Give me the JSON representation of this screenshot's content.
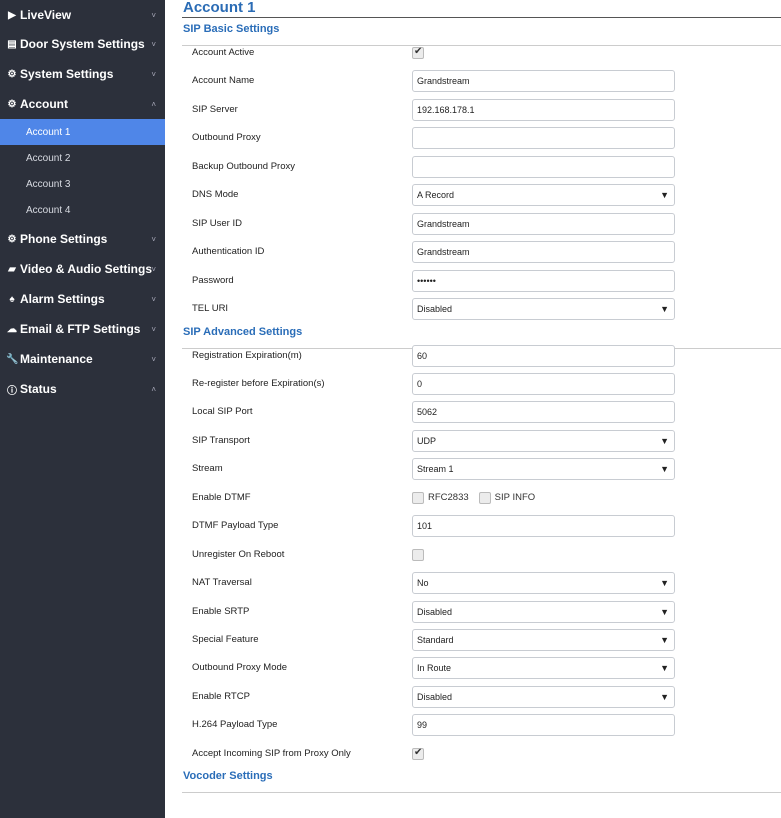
{
  "sidebar": {
    "items": [
      {
        "label": "LiveView",
        "icon": "video-play-icon",
        "glyph": "▶",
        "chev": "˅"
      },
      {
        "label": "Door System Settings",
        "icon": "door-card-icon",
        "glyph": "▤",
        "chev": "˅"
      },
      {
        "label": "System Settings",
        "icon": "gears-icon",
        "glyph": "⚙",
        "chev": "˅"
      },
      {
        "label": "Account",
        "icon": "gears-icon",
        "glyph": "⚙",
        "chev": "˄"
      },
      {
        "label": "Phone Settings",
        "icon": "gears-icon",
        "glyph": "⚙",
        "chev": "˅"
      },
      {
        "label": "Video & Audio Settings",
        "icon": "camera-icon",
        "glyph": "▰",
        "chev": "˅"
      },
      {
        "label": "Alarm Settings",
        "icon": "bell-icon",
        "glyph": "♠",
        "chev": "˅"
      },
      {
        "label": "Email & FTP Settings",
        "icon": "cloud-icon",
        "glyph": "☁",
        "chev": "˅"
      },
      {
        "label": "Maintenance",
        "icon": "wrench-icon",
        "glyph": "🔧",
        "chev": "˅"
      },
      {
        "label": "Status",
        "icon": "info-icon",
        "glyph": "ⓘ",
        "chev": "˄"
      }
    ],
    "sub_items": [
      {
        "label": "Account 1",
        "active": true
      },
      {
        "label": "Account 2"
      },
      {
        "label": "Account 3"
      },
      {
        "label": "Account 4"
      }
    ]
  },
  "main": {
    "title": "Account 1",
    "sections": [
      {
        "title": "SIP Basic Settings",
        "rows": [
          {
            "label": "Account Active",
            "type": "checkbox",
            "checked": true
          },
          {
            "label": "Account Name",
            "type": "text",
            "value": "Grandstream"
          },
          {
            "label": "SIP Server",
            "type": "text",
            "value": "192.168.178.1"
          },
          {
            "label": "Outbound Proxy",
            "type": "text",
            "value": ""
          },
          {
            "label": "Backup Outbound Proxy",
            "type": "text",
            "value": ""
          },
          {
            "label": "DNS Mode",
            "type": "select",
            "value": "A Record"
          },
          {
            "label": "SIP User ID",
            "type": "text",
            "value": "Grandstream"
          },
          {
            "label": "Authentication ID",
            "type": "text",
            "value": "Grandstream"
          },
          {
            "label": "Password",
            "type": "text",
            "value": "••••••"
          },
          {
            "label": "TEL URI",
            "type": "select",
            "value": "Disabled"
          }
        ]
      },
      {
        "title": "SIP Advanced Settings",
        "rows": [
          {
            "label": "Registration Expiration(m)",
            "type": "text",
            "value": "60"
          },
          {
            "label": "Re-register before Expiration(s)",
            "type": "text",
            "value": "0"
          },
          {
            "label": "Local SIP Port",
            "type": "text",
            "value": "5062"
          },
          {
            "label": "SIP Transport",
            "type": "select",
            "value": "UDP"
          },
          {
            "label": "Stream",
            "type": "select",
            "value": "Stream 1"
          },
          {
            "label": "Enable DTMF",
            "type": "multicheck",
            "options": [
              {
                "label": "RFC2833",
                "checked": false
              },
              {
                "label": "SIP INFO",
                "checked": false
              }
            ]
          },
          {
            "label": "DTMF Payload Type",
            "type": "text",
            "value": "101"
          },
          {
            "label": "Unregister On Reboot",
            "type": "checkbox",
            "checked": false
          },
          {
            "label": "NAT Traversal",
            "type": "select",
            "value": "No"
          },
          {
            "label": "Enable SRTP",
            "type": "select",
            "value": "Disabled"
          },
          {
            "label": "Special Feature",
            "type": "select",
            "value": "Standard"
          },
          {
            "label": "Outbound Proxy Mode",
            "type": "select",
            "value": "In Route"
          },
          {
            "label": "Enable RTCP",
            "type": "select",
            "value": "Disabled"
          },
          {
            "label": "H.264 Payload Type",
            "type": "text",
            "value": "99"
          },
          {
            "label": "Accept Incoming SIP from Proxy Only",
            "type": "checkbox",
            "checked": true
          }
        ]
      },
      {
        "title": "Vocoder Settings",
        "rows": []
      }
    ]
  },
  "colors": {
    "sidebar_bg": "#2c303b",
    "active": "#4f86e8",
    "section": "#2a6db8"
  }
}
